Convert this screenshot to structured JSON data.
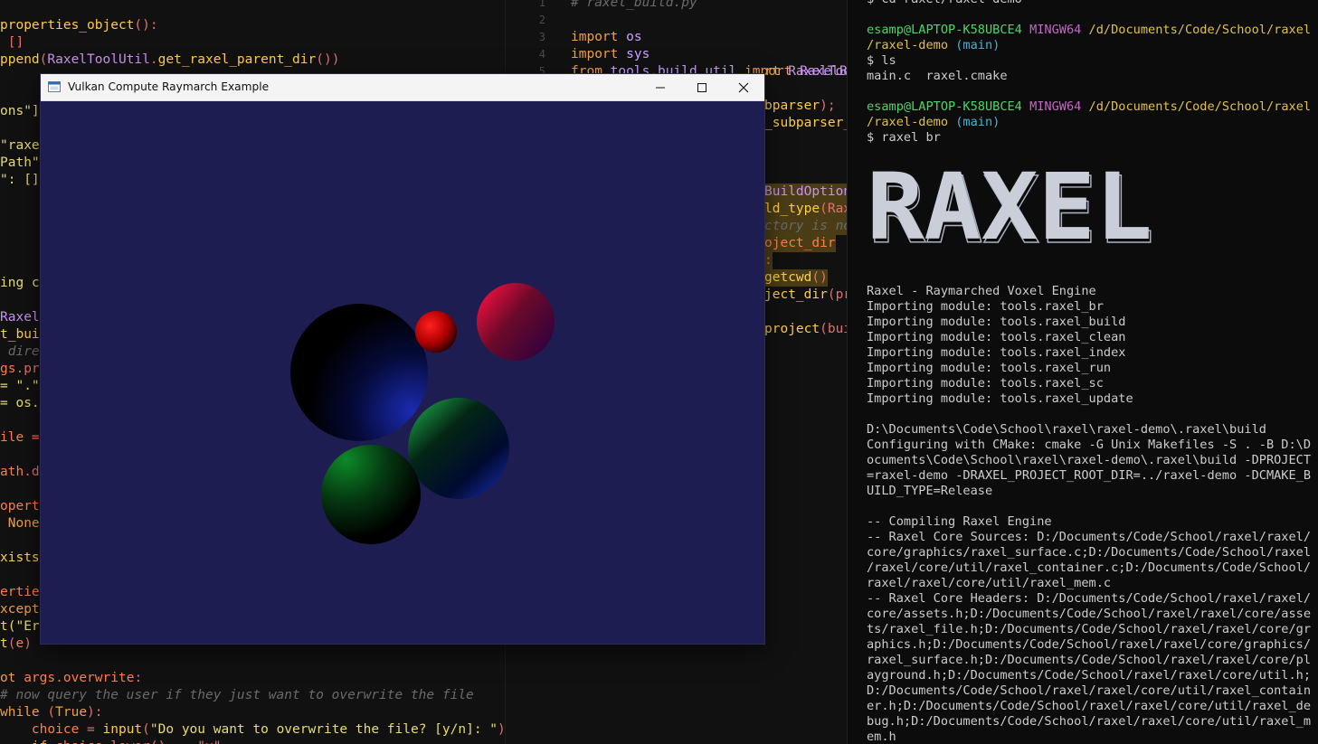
{
  "left_editor": {
    "lines": [
      [
        [
          "properties_object",
          "fn"
        ],
        [
          "():",
          "pn"
        ]
      ],
      [
        [
          " []",
          "pn"
        ]
      ],
      [
        [
          "ppend",
          "fn"
        ],
        [
          "(",
          "pn"
        ],
        [
          "RaxelToolUtil",
          "cls"
        ],
        [
          ".",
          "pn"
        ],
        [
          "get_raxel_parent_dir",
          "fn"
        ],
        [
          "())",
          "pn"
        ]
      ],
      [],
      [],
      [
        [
          "ons\"]",
          "str"
        ]
      ],
      [],
      [
        [
          "\"raxe",
          "str"
        ]
      ],
      [
        [
          "Path\"",
          "str"
        ]
      ],
      [
        [
          "\": []",
          "str"
        ]
      ],
      [],
      [],
      [],
      [],
      [],
      [
        [
          "ing c",
          "str"
        ]
      ],
      [],
      [
        [
          "Raxel",
          "cls"
        ]
      ],
      [
        [
          "t_bui",
          "fn"
        ]
      ],
      [
        [
          " dire",
          "cm"
        ]
      ],
      [
        [
          "gs",
          "var"
        ],
        [
          ".pr",
          "pn"
        ]
      ],
      [
        [
          "= \".\"",
          "str"
        ]
      ],
      [
        [
          "= os.",
          "str"
        ]
      ],
      [],
      [
        [
          "ile =",
          "var"
        ]
      ],
      [],
      [
        [
          "ath",
          "var"
        ],
        [
          ".d",
          "pn"
        ]
      ],
      [],
      [
        [
          "opert",
          "var"
        ]
      ],
      [
        [
          " None",
          "kw"
        ]
      ],
      [],
      [
        [
          "xists",
          "fn"
        ]
      ],
      [],
      [
        [
          "ertie",
          "var"
        ]
      ],
      [
        [
          "xcept",
          "kw"
        ]
      ],
      [
        [
          "t",
          "fn"
        ],
        [
          "(\"Er",
          "str"
        ]
      ],
      [
        [
          "t",
          "fn"
        ],
        [
          "(",
          "pn"
        ],
        [
          "e",
          "var"
        ],
        [
          ")",
          "pn"
        ]
      ],
      [],
      [
        [
          "ot ",
          "kw"
        ],
        [
          "args",
          "var"
        ],
        [
          ".",
          "pn"
        ],
        [
          "overwrite",
          "var"
        ],
        [
          ":",
          "pn"
        ]
      ],
      [
        [
          "# now query the user if they just want to overwrite the file",
          "cm"
        ]
      ],
      [
        [
          "while ",
          "kw"
        ],
        [
          "(",
          "pn"
        ],
        [
          "True",
          "kw"
        ],
        [
          "):",
          "pn"
        ]
      ],
      [
        [
          "    ",
          ""
        ],
        [
          "choice",
          "var"
        ],
        [
          " = ",
          "pn"
        ],
        [
          "input",
          "fn"
        ],
        [
          "(",
          "pn"
        ],
        [
          "\"Do you want to overwrite the file? [y/n]: \"",
          "str"
        ],
        [
          ")",
          "pn"
        ]
      ],
      [
        [
          "    ",
          ""
        ],
        [
          "if ",
          "kw"
        ],
        [
          "choice",
          "var"
        ],
        [
          ".lower() == \"y\"",
          "pn"
        ]
      ]
    ]
  },
  "mid_editor": {
    "lines": [
      {
        "n": "1",
        "t": [
          [
            "# raxel_build.py",
            "cm"
          ]
        ]
      },
      {
        "n": "2",
        "t": []
      },
      {
        "n": "3",
        "t": [
          [
            "import ",
            "kw"
          ],
          [
            "os",
            "mod"
          ]
        ]
      },
      {
        "n": "4",
        "t": [
          [
            "import ",
            "kw"
          ],
          [
            "sys",
            "mod"
          ]
        ]
      },
      {
        "n": "5",
        "t": [
          [
            "from ",
            "kw"
          ],
          [
            "tools.build_util ",
            "mod"
          ],
          [
            "import ",
            "kw"
          ],
          [
            "RaxelBu",
            "cls"
          ]
        ]
      },
      {
        "n": "",
        "t": []
      },
      {
        "n": "",
        "t": []
      },
      {
        "n": "",
        "t": []
      },
      {
        "n": "",
        "t": []
      },
      {
        "n": "",
        "t": []
      },
      {
        "n": "",
        "t": []
      },
      {
        "n": "",
        "t": []
      },
      {
        "n": "",
        "t": []
      },
      {
        "n": "",
        "t": []
      },
      {
        "n": "",
        "t": []
      },
      {
        "n": "",
        "t": []
      },
      {
        "n": "",
        "t": []
      },
      {
        "n": "",
        "t": []
      },
      {
        "n": "",
        "t": []
      },
      {
        "n": "",
        "t": []
      },
      {
        "n": "",
        "t": []
      }
    ],
    "peek": [
      {
        "row": 4,
        "t": [
          [
            "rt ",
            "kw"
          ],
          [
            "RaxelToo",
            "cls"
          ]
        ]
      },
      {
        "row": 6,
        "t": [
          [
            "bparser",
            "fn"
          ],
          [
            ");",
            "pn"
          ]
        ]
      },
      {
        "row": 7,
        "t": [
          [
            "_subparser",
            "fn"
          ],
          [
            "_",
            "pn"
          ]
        ]
      },
      {
        "row": 11,
        "t": [
          [
            "BuildOption",
            "cls"
          ]
        ],
        "hl": true
      },
      {
        "row": 12,
        "t": [
          [
            "ld_type",
            "fn"
          ],
          [
            "(Rax",
            "pn"
          ]
        ],
        "hl": true
      },
      {
        "row": 13,
        "t": [
          [
            "ctory is no",
            "cm"
          ]
        ],
        "hl": true
      },
      {
        "row": 14,
        "t": [
          [
            "oject_dir",
            "var"
          ]
        ],
        "hl": true
      },
      {
        "row": 15,
        "t": [
          [
            ":",
            "pn"
          ]
        ],
        "hl": true
      },
      {
        "row": 16,
        "t": [
          [
            "getcwd",
            "fn"
          ],
          [
            "()",
            "pn"
          ]
        ],
        "hl": true
      },
      {
        "row": 17,
        "t": [
          [
            "ject_dir",
            "fn"
          ],
          [
            "(pr",
            "pn"
          ]
        ]
      },
      {
        "row": 19,
        "t": [
          [
            "project",
            "fn"
          ],
          [
            "(bui",
            "pn"
          ]
        ]
      }
    ]
  },
  "terminal": {
    "lines": [
      [
        [
          "$ cd raxel/raxel-demo",
          ""
        ]
      ],
      [],
      [
        [
          "esamp@LAPTOP-K58UBCE4 ",
          "t-user"
        ],
        [
          "MINGW64 ",
          "t-host"
        ],
        [
          "/d/Documents/Code/School/raxel",
          "t-path"
        ]
      ],
      [
        [
          "/raxel-demo ",
          "t-path"
        ],
        [
          "(main)",
          "t-branch"
        ]
      ],
      [
        [
          "$ ls",
          ""
        ]
      ],
      [
        [
          "main.c  raxel.cmake",
          ""
        ]
      ],
      [],
      [
        [
          "esamp@LAPTOP-K58UBCE4 ",
          "t-user"
        ],
        [
          "MINGW64 ",
          "t-host"
        ],
        [
          "/d/Documents/Code/School/raxel",
          "t-path"
        ]
      ],
      [
        [
          "/raxel-demo ",
          "t-path"
        ],
        [
          "(main)",
          "t-branch"
        ]
      ],
      [
        [
          "$ raxel br",
          ""
        ]
      ],
      [],
      [],
      [],
      [],
      [],
      [],
      [],
      [],
      [],
      [
        [
          "Raxel - Raymarched Voxel Engine",
          ""
        ]
      ],
      [
        [
          "Importing module: tools.raxel_br",
          ""
        ]
      ],
      [
        [
          "Importing module: tools.raxel_build",
          ""
        ]
      ],
      [
        [
          "Importing module: tools.raxel_clean",
          ""
        ]
      ],
      [
        [
          "Importing module: tools.raxel_index",
          ""
        ]
      ],
      [
        [
          "Importing module: tools.raxel_run",
          ""
        ]
      ],
      [
        [
          "Importing module: tools.raxel_sc",
          ""
        ]
      ],
      [
        [
          "Importing module: tools.raxel_update",
          ""
        ]
      ],
      [],
      [
        [
          "D:\\Documents\\Code\\School\\raxel\\raxel-demo\\.raxel\\build",
          ""
        ]
      ],
      [
        [
          "Configuring with CMake: cmake -G Unix Makefiles -S . -B D:\\D",
          ""
        ]
      ],
      [
        [
          "ocuments\\Code\\School\\raxel\\raxel-demo\\.raxel\\build -DPROJECT",
          ""
        ]
      ],
      [
        [
          "=raxel-demo -DRAXEL_PROJECT_ROOT_DIR=../raxel-demo -DCMAKE_B",
          ""
        ]
      ],
      [
        [
          "UILD_TYPE=Release",
          ""
        ]
      ],
      [],
      [
        [
          "-- Compiling Raxel Engine",
          ""
        ]
      ],
      [
        [
          "-- Raxel Core Sources: D:/Documents/Code/School/raxel/raxel/",
          ""
        ]
      ],
      [
        [
          "core/graphics/raxel_surface.c;D:/Documents/Code/School/raxel",
          ""
        ]
      ],
      [
        [
          "/raxel/core/util/raxel_container.c;D:/Documents/Code/School/",
          ""
        ]
      ],
      [
        [
          "raxel/raxel/core/util/raxel_mem.c",
          ""
        ]
      ],
      [
        [
          "-- Raxel Core Headers: D:/Documents/Code/School/raxel/raxel/",
          ""
        ]
      ],
      [
        [
          "core/assets.h;D:/Documents/Code/School/raxel/raxel/core/asse",
          ""
        ]
      ],
      [
        [
          "ts/raxel_file.h;D:/Documents/Code/School/raxel/raxel/core/gr",
          ""
        ]
      ],
      [
        [
          "aphics.h;D:/Documents/Code/School/raxel/raxel/core/graphics/",
          ""
        ]
      ],
      [
        [
          "raxel_surface.h;D:/Documents/Code/School/raxel/raxel/core/pl",
          ""
        ]
      ],
      [
        [
          "ayground.h;D:/Documents/Code/School/raxel/raxel/core/util.h;",
          ""
        ]
      ],
      [
        [
          "D:/Documents/Code/School/raxel/raxel/core/util/raxel_contain",
          ""
        ]
      ],
      [
        [
          "er.h;D:/Documents/Code/School/raxel/raxel/core/util/raxel_de",
          ""
        ]
      ],
      [
        [
          "bug.h;D:/Documents/Code/School/raxel/raxel/core/util/raxel_m",
          ""
        ]
      ],
      [
        [
          "em.h",
          ""
        ]
      ]
    ],
    "banner": "RAXEL"
  },
  "window": {
    "title": "Vulkan Compute Raymarch Example",
    "min_glyph": "─",
    "max_glyph": "☐",
    "close_glyph": "✕",
    "background": "#1d1d52"
  },
  "scene": {
    "spheres": [
      {
        "name": "sphere-large-blue",
        "color": "#1a2aa8"
      },
      {
        "name": "sphere-small-red",
        "color": "#ff1a1a"
      },
      {
        "name": "sphere-magenta",
        "color": "#e0153c"
      },
      {
        "name": "sphere-green-blue",
        "color": "#1fa64a"
      },
      {
        "name": "sphere-green",
        "color": "#0fa030"
      }
    ]
  }
}
